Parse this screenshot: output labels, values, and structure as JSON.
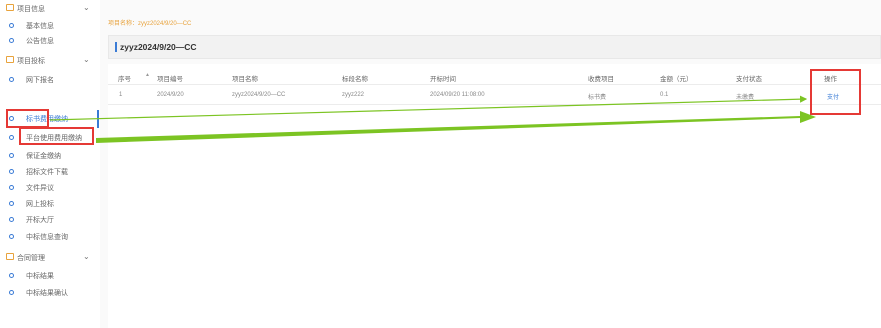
{
  "sidebar": {
    "groups": [
      {
        "label": "项目信息",
        "items": [
          "基本信息",
          "公告信息"
        ]
      },
      {
        "label": "项目投标",
        "items": [
          "网下报名",
          "标书费用缴纳",
          "平台使用费用缴纳",
          "保证金缴纳",
          "招标文件下载",
          "文件异议",
          "网上投标",
          "开标大厅",
          "中标信息查询"
        ]
      },
      {
        "label": "合同管理",
        "items": [
          "中标结果",
          "中标结果确认"
        ]
      }
    ],
    "chevron": "⌄"
  },
  "breadcrumb": "项目名称：zyyz2024/9/20—CC",
  "page_title": "zyyz2024/9/20—CC",
  "table": {
    "headers": [
      "序号",
      "项目编号",
      "项目名称",
      "标段名称",
      "开标时间",
      "收费项目",
      "金额（元）",
      "支付状态",
      "操作"
    ],
    "rows": [
      [
        "1",
        "2024/9/20",
        "zyyz2024/9/20—CC",
        "zyyz222",
        "2024/09/20 11:08:00",
        "标书费",
        "0.1",
        "未缴费",
        "支付"
      ]
    ]
  },
  "colors": {
    "accent": "#3a7bd5",
    "orange": "#e8a33d",
    "highlight": "#e53935",
    "arrow": "#7cc423"
  }
}
